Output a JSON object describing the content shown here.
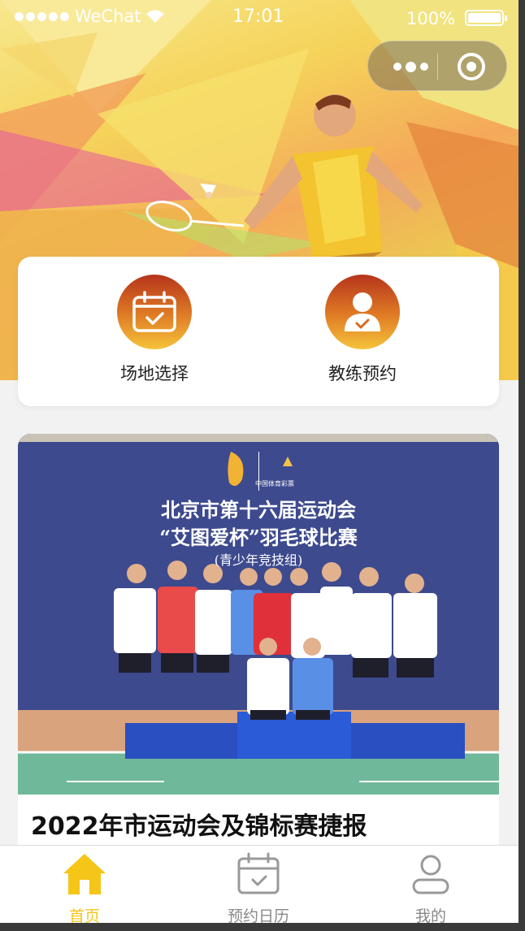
{
  "status_bar": {
    "carrier": "WeChat",
    "time": "17:01",
    "battery": "100%"
  },
  "quick_actions": [
    {
      "label": "场地选择",
      "icon": "calendar-check-icon"
    },
    {
      "label": "教练预约",
      "icon": "coach-person-icon"
    }
  ],
  "news": {
    "title": "2022年市运动会及锦标赛捷报",
    "photo": {
      "banner_line1": "北京市第十六届运动会",
      "banner_line2": "“艾图爱杯”羽毛球比赛",
      "banner_line3": "(青少年竞技组)",
      "logo_text": "中国体育彩票"
    }
  },
  "tabbar": {
    "active_color": "#f5c518",
    "inactive_color": "#888888",
    "items": [
      {
        "label": "首页",
        "icon": "home-icon",
        "active": true
      },
      {
        "label": "预约日历",
        "icon": "calendar-icon",
        "active": false
      },
      {
        "label": "我的",
        "icon": "user-icon",
        "active": false
      }
    ]
  }
}
